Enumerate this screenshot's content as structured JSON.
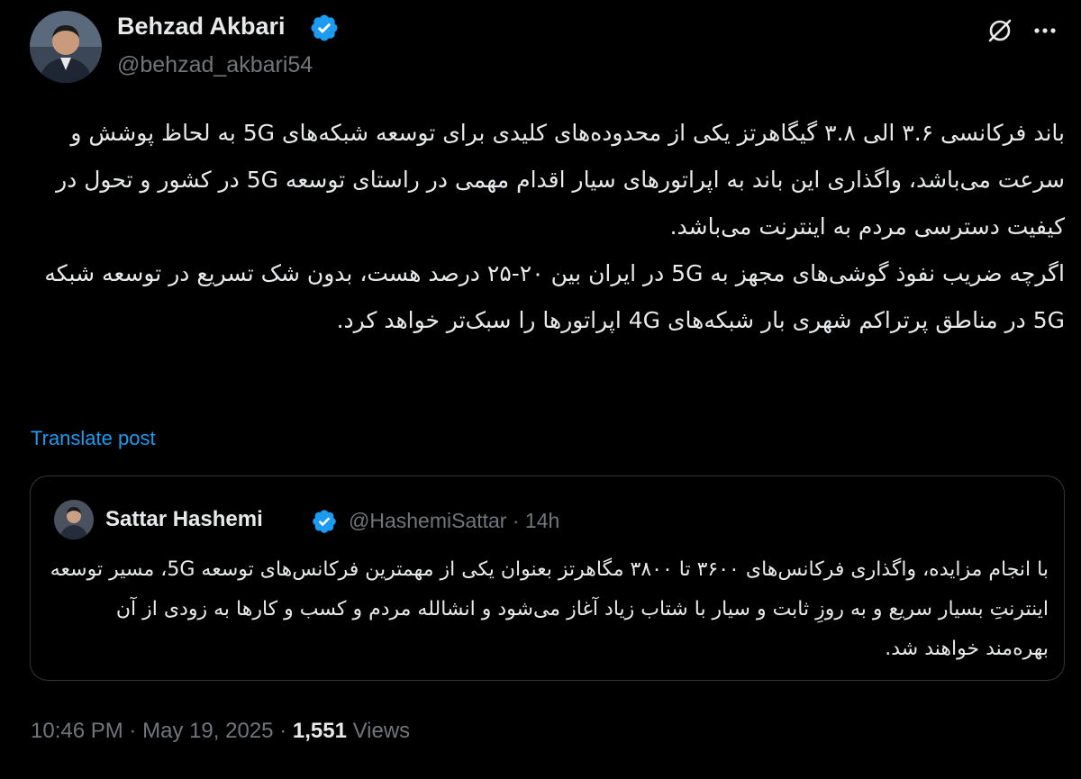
{
  "author": {
    "name": "Behzad Akbari",
    "handle": "@behzad_akbari54",
    "verified": true
  },
  "icons": {
    "verified": "verified-badge-icon",
    "grok": "grok-icon",
    "more": "more-horizontal-icon"
  },
  "tweet": {
    "paragraphs": [
      "باند فرکانسی ۳.۶ الی ۳.۸ گیگاهرتز یکی از محدوده‌های کلیدی برای توسعه شبکه‌های 5G به لحاظ پوشش و سرعت می‌باشد، واگذاری این باند به اپراتورهای سیار اقدام مهمی در راستای توسعه 5G در کشور و تحول در کیفیت دسترسی مردم به اینترنت می‌باشد.",
      "اگرچه ضریب نفوذ گوشی‌های مجهز به 5G در ایران بین ۲۰-۲۵ درصد هست، بدون شک تسریع در توسعه شبکه 5G در مناطق پرتراکم شهری بار شبکه‌های 4G اپراتورها را سبک‌تر خواهد کرد."
    ],
    "translate_label": "Translate post"
  },
  "quote": {
    "name": "Sattar Hashemi",
    "handle": "@HashemiSattar",
    "separator": "·",
    "time": "14h",
    "text": "با انجام مزایده، واگذاری فرکانس‌های ۳۶۰۰ تا ۳۸۰۰ مگاهرتز بعنوان یکی از مهمترین فرکانس‌های توسعه 5G، مسیر توسعه اینترنتِ بسیار سریع و به روزِ ثابت و سیار با شتاب زیاد آغاز می‌شود و انشالله مردم و کسب و کارها به زودی از آن بهره‌مند خواهند شد."
  },
  "footer": {
    "time": "10:46 PM",
    "separator": "·",
    "date": "May 19, 2025",
    "views_count": "1,551",
    "views_label": "Views"
  },
  "colors": {
    "background": "#000000",
    "text": "#e7e9ea",
    "secondary": "#71767b",
    "link": "#1d9bf0",
    "border": "#333639",
    "verified": "#1d9bf0"
  }
}
